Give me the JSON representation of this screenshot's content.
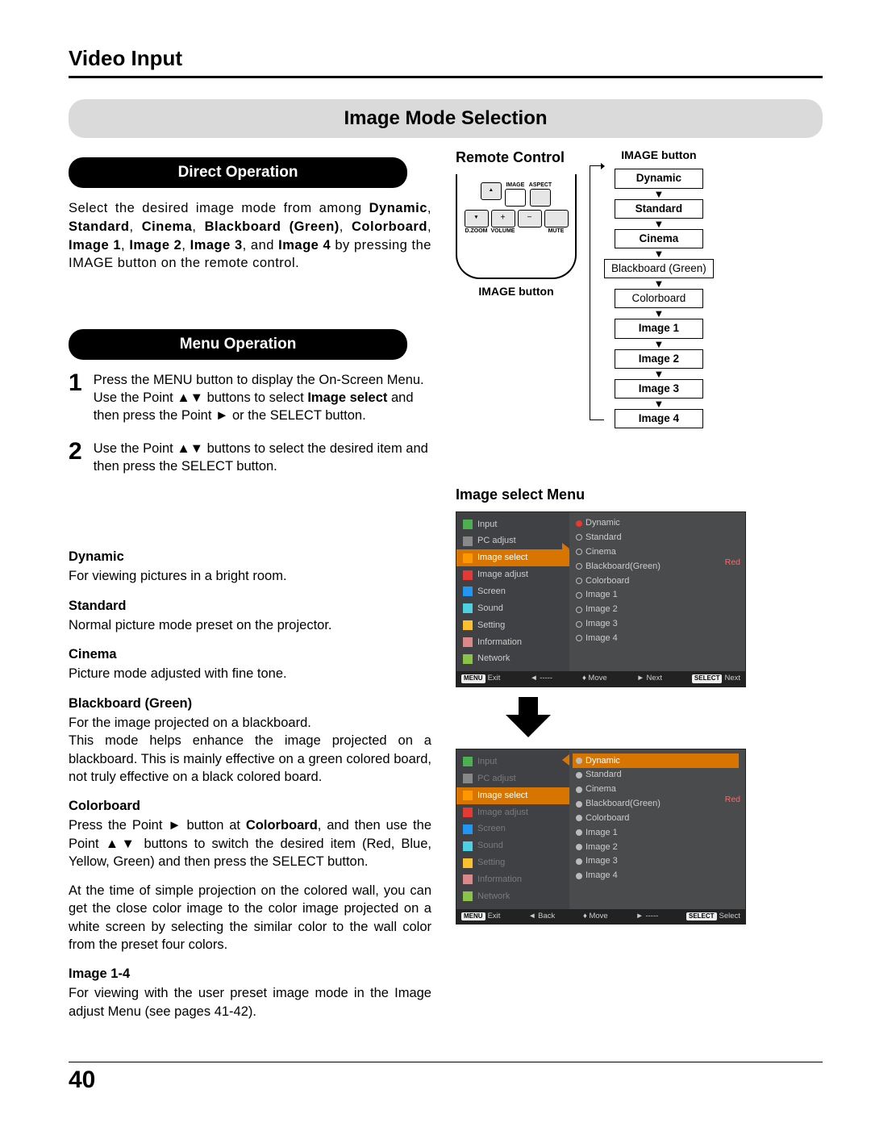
{
  "page": {
    "header": "Video Input",
    "section_title": "Image Mode Selection",
    "page_number": "40"
  },
  "pills": {
    "direct": "Direct Operation",
    "menu": "Menu Operation"
  },
  "direct_para": "Select the desired image mode from among <b>Dynamic</b>, <b>Standard</b>, <b>Cinema</b>, <b>Blackboard (Green)</b>, <b>Colorboard</b>, <b>Image 1</b>, <b>Image 2</b>, <b>Image 3</b>, and <b>Image 4</b> by pressing the IMAGE button on the remote control.",
  "steps": [
    {
      "n": "1",
      "t": "Press the MENU button to display the On-Screen Menu. Use the Point ▲▼ buttons to select <b>Image select</b> and then press the Point ► or the SELECT button."
    },
    {
      "n": "2",
      "t": "Use the Point ▲▼ buttons to select the desired item and then press the SELECT button."
    }
  ],
  "modes": [
    {
      "name": "Dynamic",
      "desc": "For viewing pictures in a bright room."
    },
    {
      "name": "Standard",
      "desc": "Normal picture mode preset on the projector."
    },
    {
      "name": "Cinema",
      "desc": "Picture mode adjusted with fine tone."
    },
    {
      "name": "Blackboard (Green)",
      "desc": "For the image projected on a blackboard.\nThis mode helps enhance the image projected on a blackboard. This is mainly effective on a green colored board, not truly effective on a black colored board."
    },
    {
      "name": "Colorboard",
      "desc": "Press the Point ► button at <b>Colorboard</b>, and then use the Point ▲▼ buttons to switch the desired item (Red, Blue, Yellow, Green) and then press the SELECT button."
    },
    {
      "name_extra": "",
      "desc": "At the time of simple projection on the colored wall, you can get the close color image to the color image projected on a white screen by selecting the similar color to the wall color from the preset four colors."
    },
    {
      "name": "Image 1-4",
      "desc": "For viewing with the user preset image mode in the Image adjust Menu (see pages 41-42)."
    }
  ],
  "remote": {
    "heading": "Remote Control",
    "caption": "IMAGE button",
    "row1_labels": [
      "IMAGE",
      "ASPECT"
    ],
    "row2_labels": [
      "D.ZOOM",
      "VOLUME",
      "MUTE"
    ]
  },
  "flow": {
    "title": "IMAGE button",
    "items": [
      "Dynamic",
      "Standard",
      "Cinema",
      "Blackboard (Green)",
      "Colorboard",
      "Image 1",
      "Image 2",
      "Image 3",
      "Image 4"
    ]
  },
  "osd_heading": "Image select Menu",
  "osd_menu_items": [
    {
      "label": "Input",
      "icon": "oi-green"
    },
    {
      "label": "PC adjust",
      "icon": "oi-grey"
    },
    {
      "label": "Image select",
      "icon": "oi-orange"
    },
    {
      "label": "Image adjust",
      "icon": "oi-red"
    },
    {
      "label": "Screen",
      "icon": "oi-blue"
    },
    {
      "label": "Sound",
      "icon": "oi-teal"
    },
    {
      "label": "Setting",
      "icon": "oi-yel"
    },
    {
      "label": "Information",
      "icon": "oi-info"
    },
    {
      "label": "Network",
      "icon": "oi-net"
    }
  ],
  "osd_options": [
    "Dynamic",
    "Standard",
    "Cinema",
    "Blackboard(Green)",
    "Colorboard",
    "Image 1",
    "Image 2",
    "Image 3",
    "Image 4"
  ],
  "osd_side_label": "Red",
  "osd_footer1": {
    "exit": "Exit",
    "exit_key": "MENU",
    "b": "-----",
    "move": "Move",
    "next": "Next",
    "select": "Next",
    "select_key": "SELECT"
  },
  "osd_footer2": {
    "exit": "Exit",
    "exit_key": "MENU",
    "back": "Back",
    "move": "Move",
    "next": "-----",
    "select": "Select",
    "select_key": "SELECT"
  }
}
